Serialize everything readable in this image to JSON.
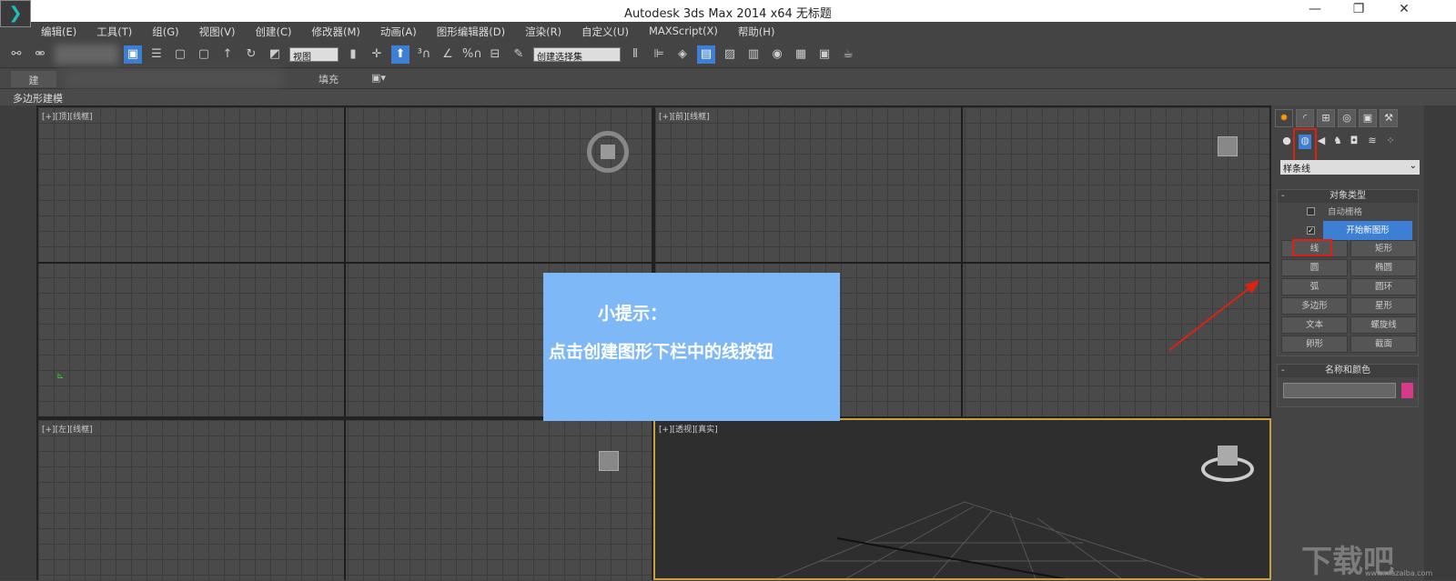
{
  "window": {
    "title": "Autodesk 3ds Max  2014 x64     无标题",
    "minimize": "—",
    "restore": "❐",
    "close": "✕"
  },
  "menu": [
    "编辑(E)",
    "工具(T)",
    "组(G)",
    "视图(V)",
    "创建(C)",
    "修改器(M)",
    "动画(A)",
    "图形编辑器(D)",
    "渲染(R)",
    "自定义(U)",
    "MAXScript(X)",
    "帮助(H)"
  ],
  "toolbar": {
    "view_select": "视图",
    "selection_set": "创建选择集"
  },
  "ribbon": {
    "tab_build": "建",
    "tab_fill": "填充",
    "sub_label": "多边形建模"
  },
  "viewports": {
    "top": "[+][顶][线框]",
    "front": "[+][前][线框]",
    "left": "[+][左][线框]",
    "perspective": "[+][透视][真实]"
  },
  "tip": {
    "title": "小提示：",
    "body": "点击创建图形下栏中的线按钮",
    "bg": "#7eb8f6"
  },
  "command_panel": {
    "category_dropdown": "样条线",
    "object_type": {
      "title": "对象类型",
      "auto_grid": "自动栅格",
      "start_new_shape": "开始新图形",
      "buttons": [
        "线",
        "矩形",
        "圆",
        "椭圆",
        "弧",
        "圆环",
        "多边形",
        "星形",
        "文本",
        "螺旋线",
        "卵形",
        "截面"
      ]
    },
    "name_color": {
      "title": "名称和颜色",
      "color": "#d63a8a"
    }
  },
  "watermark": {
    "text": "下载吧",
    "url": "www.xiazaiba.com"
  },
  "colors": {
    "accent": "#3d7fd4",
    "highlight": "#d21"
  }
}
